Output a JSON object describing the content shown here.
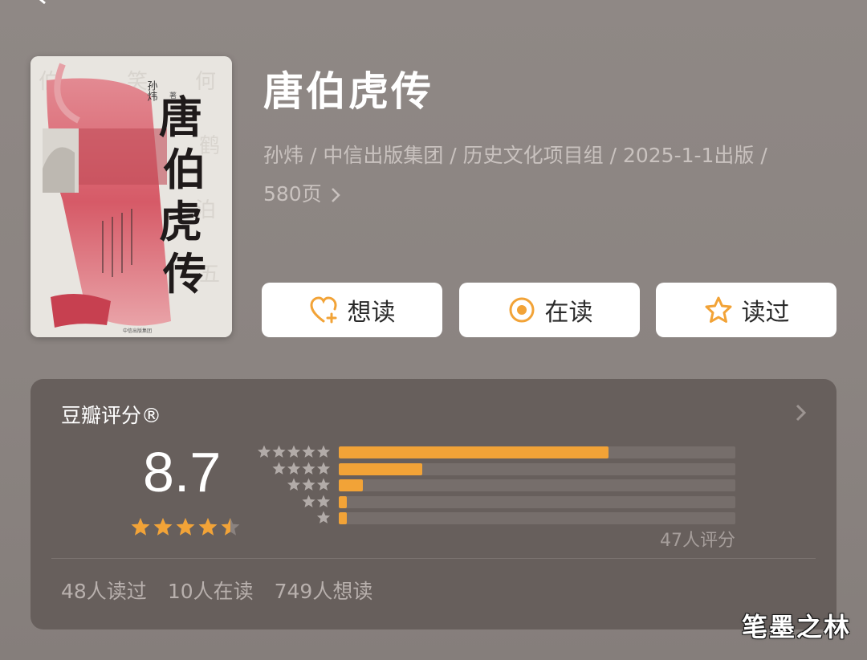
{
  "book": {
    "title": "唐伯虎传",
    "meta_line1": "孙炜 / 中信出版集团 / 历史文化项目组 / 2025-1-1出版 /",
    "meta_line2": "580页",
    "cover": {
      "title_glyphs": [
        "唐",
        "伯",
        "虎",
        "传"
      ],
      "author": "孙炜",
      "author_suffix": "著",
      "publisher": "中信出版集团"
    }
  },
  "actions": {
    "want_label": "想读",
    "reading_label": "在读",
    "read_label": "读过"
  },
  "rating": {
    "header": "豆瓣评分®",
    "score": "8.7",
    "score_stars": 4.5,
    "distribution": [
      {
        "stars": 5,
        "fraction": 0.68
      },
      {
        "stars": 4,
        "fraction": 0.21
      },
      {
        "stars": 3,
        "fraction": 0.06
      },
      {
        "stars": 2,
        "fraction": 0.02
      },
      {
        "stars": 1,
        "fraction": 0.02
      }
    ],
    "count_text": "47人评分",
    "stats": {
      "read": "48人读过",
      "reading": "10人在读",
      "want": "749人想读"
    }
  },
  "colors": {
    "accent": "#f2a337",
    "background": "#8d8683",
    "card": "#675f5c",
    "cover_red": "#d9626f"
  },
  "watermark": "笔墨之林"
}
